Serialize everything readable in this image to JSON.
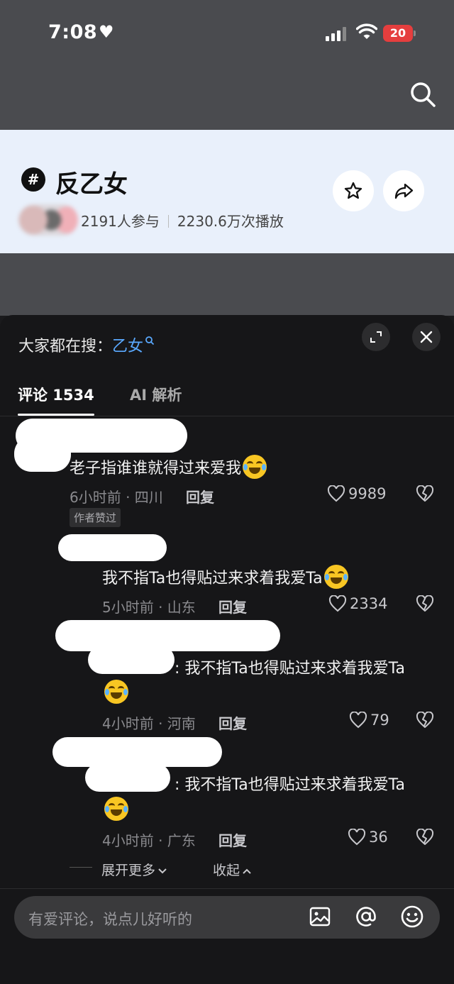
{
  "status_bar": {
    "time": "7:08",
    "battery": "20"
  },
  "topic": {
    "title": "反乙女",
    "participants": "2191人参与",
    "plays": "2230.6万次播放"
  },
  "panel": {
    "hot_search_prefix": "大家都在搜：",
    "hot_search_keyword": "乙女",
    "tabs": {
      "comments": "评论 1534",
      "ai": "AI 解析"
    }
  },
  "comments": [
    {
      "text": "老子指谁谁就得过来爱我",
      "meta": "6小时前 · 四川",
      "reply": "回复",
      "likes": "9989",
      "badge": "作者赞过"
    },
    {
      "text": "我不指Ta也得贴过来求着我爱Ta",
      "meta": "5小时前 · 山东",
      "reply": "回复",
      "likes": "2334"
    },
    {
      "text": ": 我不指Ta也得贴过来求着我爱Ta",
      "meta": "4小时前 · 河南",
      "reply": "回复",
      "likes": "79"
    },
    {
      "text": ": 我不指Ta也得贴过来求着我爱Ta",
      "meta": "4小时前 · 广东",
      "reply": "回复",
      "likes": "36"
    }
  ],
  "actions": {
    "expand_more": "展开更多",
    "collapse": "收起"
  },
  "input": {
    "placeholder": "有爱评论，说点儿好听的"
  }
}
